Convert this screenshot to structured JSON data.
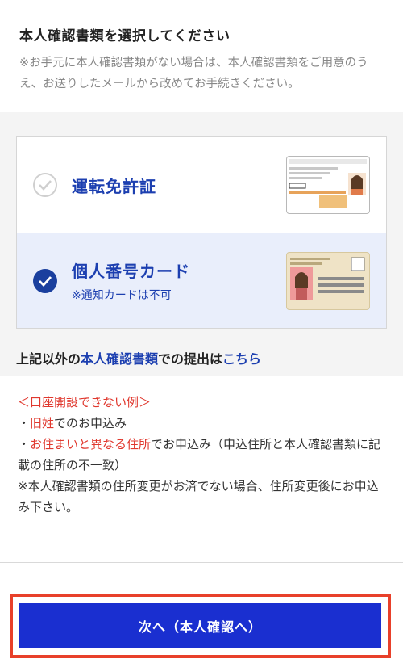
{
  "header": {
    "title": "本人確認書類を選択してください",
    "note": "※お手元に本人確認書類がない場合は、本人確認書類をご用意のうえ、お送りしたメールから改めてお手続きください。"
  },
  "options": [
    {
      "label": "運転免許証",
      "sub": "",
      "selected": false,
      "card_icon": "drivers-license-card"
    },
    {
      "label": "個人番号カード",
      "sub": "※通知カードは不可",
      "selected": true,
      "card_icon": "my-number-card"
    }
  ],
  "other_docs": {
    "prefix": "上記以外の",
    "link1": "本人確認書類",
    "middle": "での提出は",
    "link2": "こちら"
  },
  "notes": {
    "heading": "＜口座開設できない例＞",
    "line1_bullet": "・",
    "line1_red": "旧姓",
    "line1_rest": "でのお申込み",
    "line2_bullet": "・",
    "line2_red": "お住まいと異なる住所",
    "line2_rest": "でお申込み（申込住所と本人確認書類に記載の住所の不一致）",
    "line3": "※本人確認書類の住所変更がお済でない場合、住所変更後にお申込み下さい。"
  },
  "footer": {
    "next_label": "次へ（本人確認へ）"
  },
  "colors": {
    "accent": "#1c3fb0",
    "button": "#1a2fd0",
    "highlight": "#e8402a",
    "warn": "#e0382e"
  }
}
